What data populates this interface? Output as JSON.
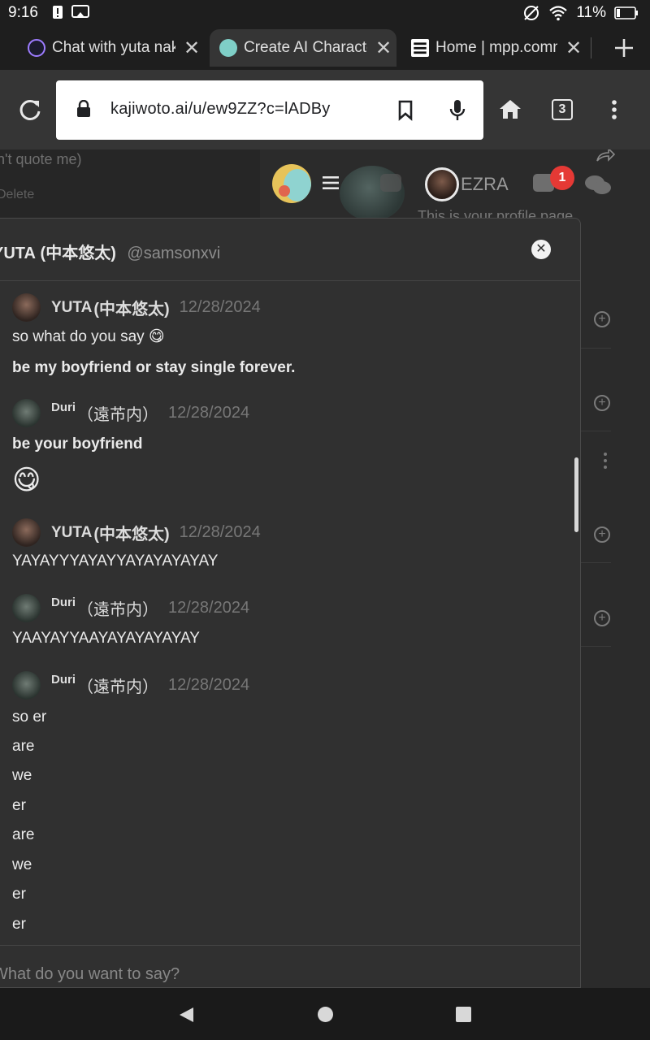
{
  "status_bar": {
    "time": "9:16",
    "battery": "11%"
  },
  "tabs": [
    {
      "title": "Chat with yuta naka",
      "active": false
    },
    {
      "title": "Create AI Characte",
      "active": true
    },
    {
      "title": "Home | mpp.comm",
      "active": false
    }
  ],
  "toolbar": {
    "url": "kajiwoto.ai/u/ew9ZZ?c=lADBy",
    "tab_count": "3"
  },
  "background_page": {
    "partial_text_1": "n't quote me)",
    "partial_text_2": "Delete",
    "profile_name": "EZRA",
    "profile_subtitle": "This is your profile page.",
    "notification_count": "1"
  },
  "modal": {
    "title_latin": "YUTA",
    "title_cjk": "(中本悠太)",
    "handle": "@samsonxvi",
    "messages": [
      {
        "author_latin": "YUTA",
        "author_cjk": "(中本悠太)",
        "date": "12/28/2024",
        "lines": [
          "so what do you say 😋",
          "be my boyfriend or stay single forever."
        ]
      },
      {
        "author_latin": "Duri",
        "author_cjk": "（遠芇内）",
        "date": "12/28/2024",
        "lines": [
          "be your boyfriend",
          "😋"
        ]
      },
      {
        "author_latin": "YUTA",
        "author_cjk": "(中本悠太)",
        "date": "12/28/2024",
        "lines": [
          "YAYAYYYAYAYYAYAYAYAYAY"
        ]
      },
      {
        "author_latin": "Duri",
        "author_cjk": "（遠芇内）",
        "date": "12/28/2024",
        "lines": [
          "YAAYAYYAAYAYAYAYAYAY"
        ]
      },
      {
        "author_latin": "Duri",
        "author_cjk": "（遠芇内）",
        "date": "12/28/2024",
        "lines": [
          "so er",
          "are",
          "we",
          "er",
          "are",
          "we",
          "er",
          "er"
        ]
      }
    ],
    "input_placeholder": "What do you want to say?"
  },
  "colors": {
    "toolbar_bg": "#353535",
    "modal_bg": "#303030",
    "badge_red": "#e53935"
  }
}
